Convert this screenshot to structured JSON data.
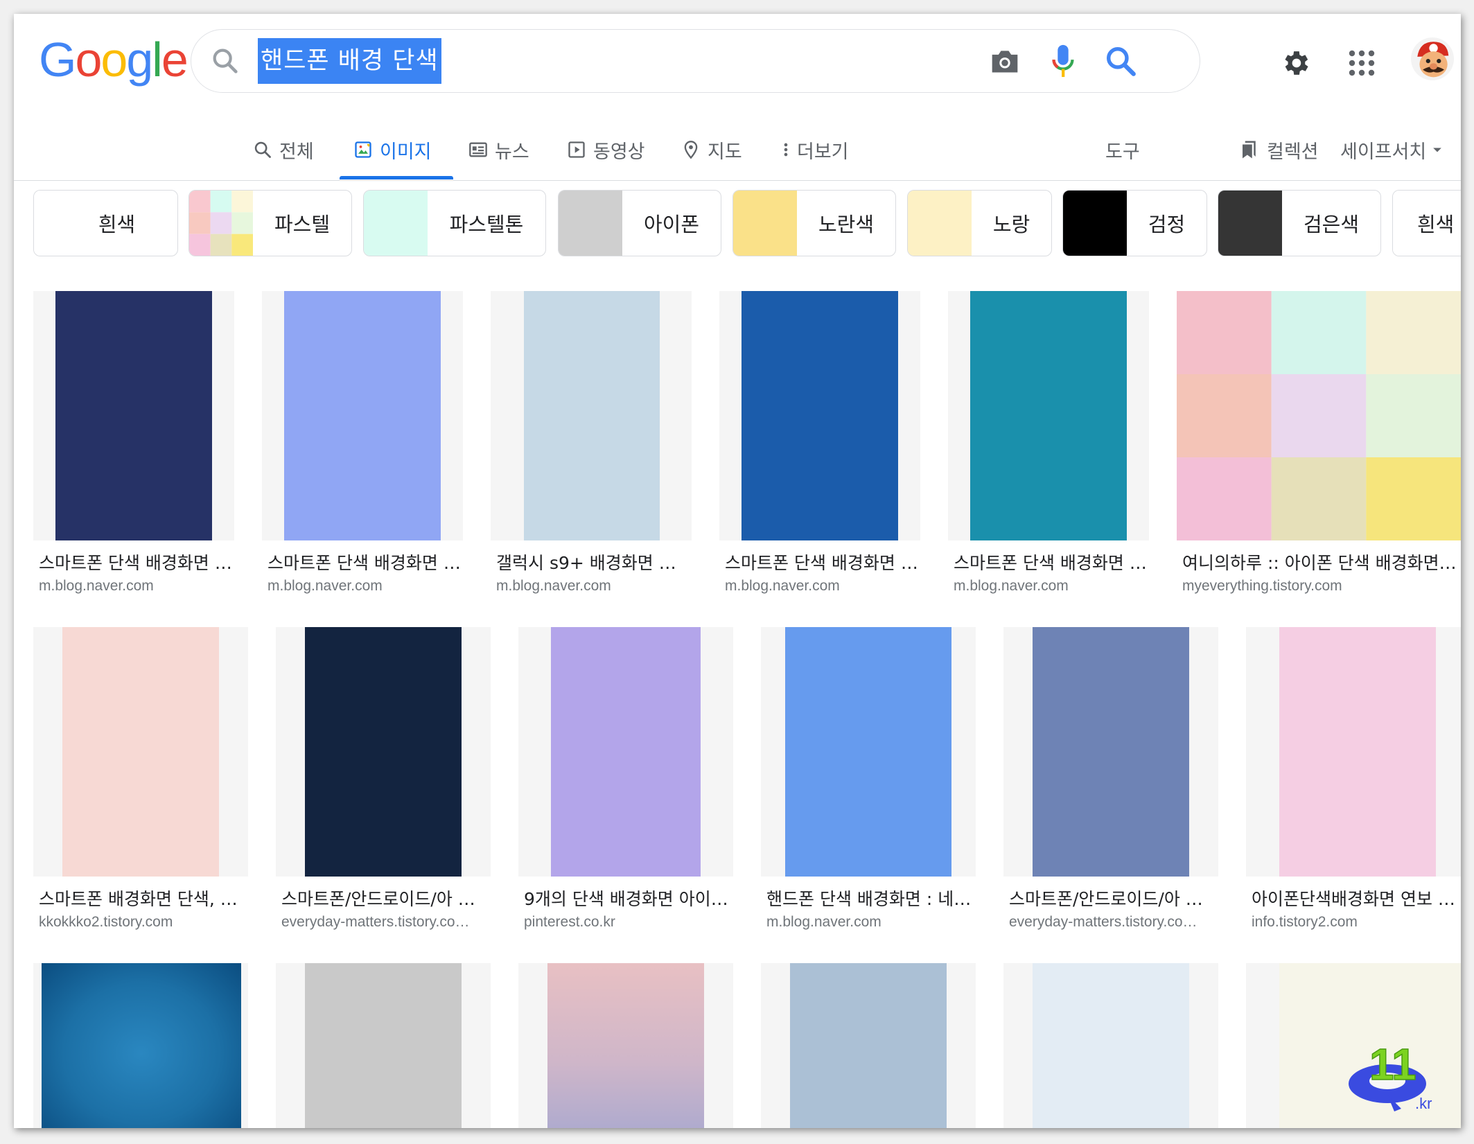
{
  "search": {
    "query": "핸드폰 배경 단색"
  },
  "tabs": [
    {
      "label": "전체",
      "icon": "search-icon"
    },
    {
      "label": "이미지",
      "icon": "image-icon",
      "active": true
    },
    {
      "label": "뉴스",
      "icon": "news-icon"
    },
    {
      "label": "동영상",
      "icon": "play-icon"
    },
    {
      "label": "지도",
      "icon": "map-pin-icon"
    },
    {
      "label": "더보기",
      "icon": "more-vert-icon"
    }
  ],
  "tools": {
    "label": "도구"
  },
  "collections": {
    "label": "컬렉션"
  },
  "safesearch": {
    "label": "세이프서치"
  },
  "chips": [
    {
      "label": "흰색",
      "color": "#ffffff"
    },
    {
      "label": "파스텔",
      "color": "pastel-grid"
    },
    {
      "label": "파스텔톤",
      "color": "#d8fbf1"
    },
    {
      "label": "아이폰",
      "color": "#cfcfcf"
    },
    {
      "label": "노란색",
      "color": "#fae189"
    },
    {
      "label": "노랑",
      "color": "#fdf1c5"
    },
    {
      "label": "검정",
      "color": "#000000"
    },
    {
      "label": "검은색",
      "color": "#353535"
    },
    {
      "label": "흰색",
      "color": "#ffffff"
    }
  ],
  "results": {
    "row1": [
      {
        "title": "스마트폰 단색 배경화면 …",
        "source": "m.blog.naver.com",
        "color": "#263266"
      },
      {
        "title": "스마트폰 단색 배경화면 …",
        "source": "m.blog.naver.com",
        "color": "#90a6f4"
      },
      {
        "title": "갤럭시 s9+ 배경화면 공 …",
        "source": "m.blog.naver.com",
        "color": "#c6d9e6"
      },
      {
        "title": "스마트폰 단색 배경화면 …",
        "source": "m.blog.naver.com",
        "color": "#1b5cab"
      },
      {
        "title": "스마트폰 단색 배경화면 …",
        "source": "m.blog.naver.com",
        "color": "#1a90ac"
      },
      {
        "title": "여니의하루 :: 아이폰 단색 배경화면 …",
        "source": "myeverything.tistory.com",
        "color": "pastel-grid"
      }
    ],
    "row2": [
      {
        "title": "스마트폰 배경화면 단색, …",
        "source": "kkokkko2.tistory.com",
        "color": "#f7d9d4"
      },
      {
        "title": "스마트폰/안드로이드/아 …",
        "source": "everyday-matters.tistory.co…",
        "color": "#132440"
      },
      {
        "title": "9개의 단색 배경화면 아이 …",
        "source": "pinterest.co.kr",
        "color": "#b3a5ea"
      },
      {
        "title": "핸드폰 단색 배경화면 : 네 …",
        "source": "m.blog.naver.com",
        "color": "#669bee"
      },
      {
        "title": "스마트폰/안드로이드/아 …",
        "source": "everyday-matters.tistory.co…",
        "color": "#6e83b5"
      },
      {
        "title": "아이폰단색배경화면 연보 …",
        "source": "info.tistory2.com",
        "color": "#f5cee3"
      }
    ],
    "row3": [
      {
        "color": "#1c70a6"
      },
      {
        "color": "#c9c9c9"
      },
      {
        "color": "#dcb8c2"
      },
      {
        "color": "#abc0d5"
      },
      {
        "color": "#e3ecf4"
      },
      {
        "color": "#f6f5e9"
      }
    ]
  },
  "watermark": {
    "number": "11",
    "domain": ".kr"
  }
}
